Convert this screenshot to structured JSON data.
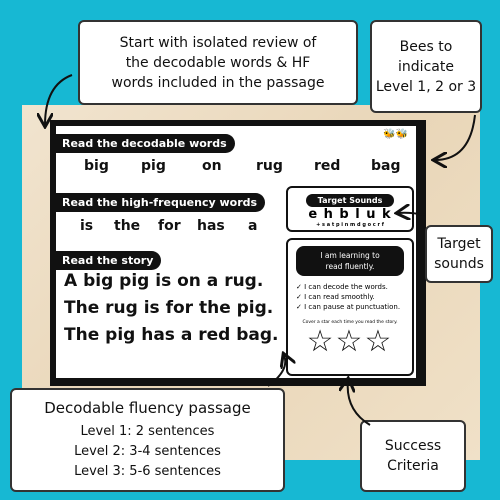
{
  "callouts": {
    "review": [
      "Start with isolated review of",
      "the decodable words & HF",
      "words included in the passage"
    ],
    "bees": [
      "Bees to",
      "indicate",
      "Level 1, 2 or 3"
    ],
    "target": [
      "Target",
      "sounds"
    ],
    "passage": {
      "title": "Decodable fluency passage",
      "levels": [
        "Level 1: 2 sentences",
        "Level 2: 3-4 sentences",
        "Level 3: 5-6 sentences"
      ]
    },
    "success": [
      "Success",
      "Criteria"
    ]
  },
  "sheet": {
    "decodable_heading": "Read the decodable words",
    "decodable_words": [
      "big",
      "pig",
      "on",
      "rug",
      "red",
      "bag"
    ],
    "hf_heading": "Read the high-frequency words",
    "hf_words": [
      "is",
      "the",
      "for",
      "has",
      "a"
    ],
    "story_heading": "Read the story",
    "story": [
      "A big pig is on a rug.",
      "The rug is for the pig.",
      "The pig has a red bag."
    ],
    "bee_level": 2,
    "target": {
      "heading": "Target Sounds",
      "sounds": "e h b l u k",
      "review": "+ s a t p i n m d g o c r f"
    },
    "goal": {
      "heading_1": "I am learning to",
      "heading_2": "read fluently.",
      "criteria": [
        "I can decode the words.",
        "I can read smoothly.",
        "I can pause at punctuation."
      ],
      "instruction": "Cover a star each time you read the story.",
      "stars": 3
    }
  },
  "colors": {
    "background": "#17b8d3",
    "ink": "#111111"
  }
}
